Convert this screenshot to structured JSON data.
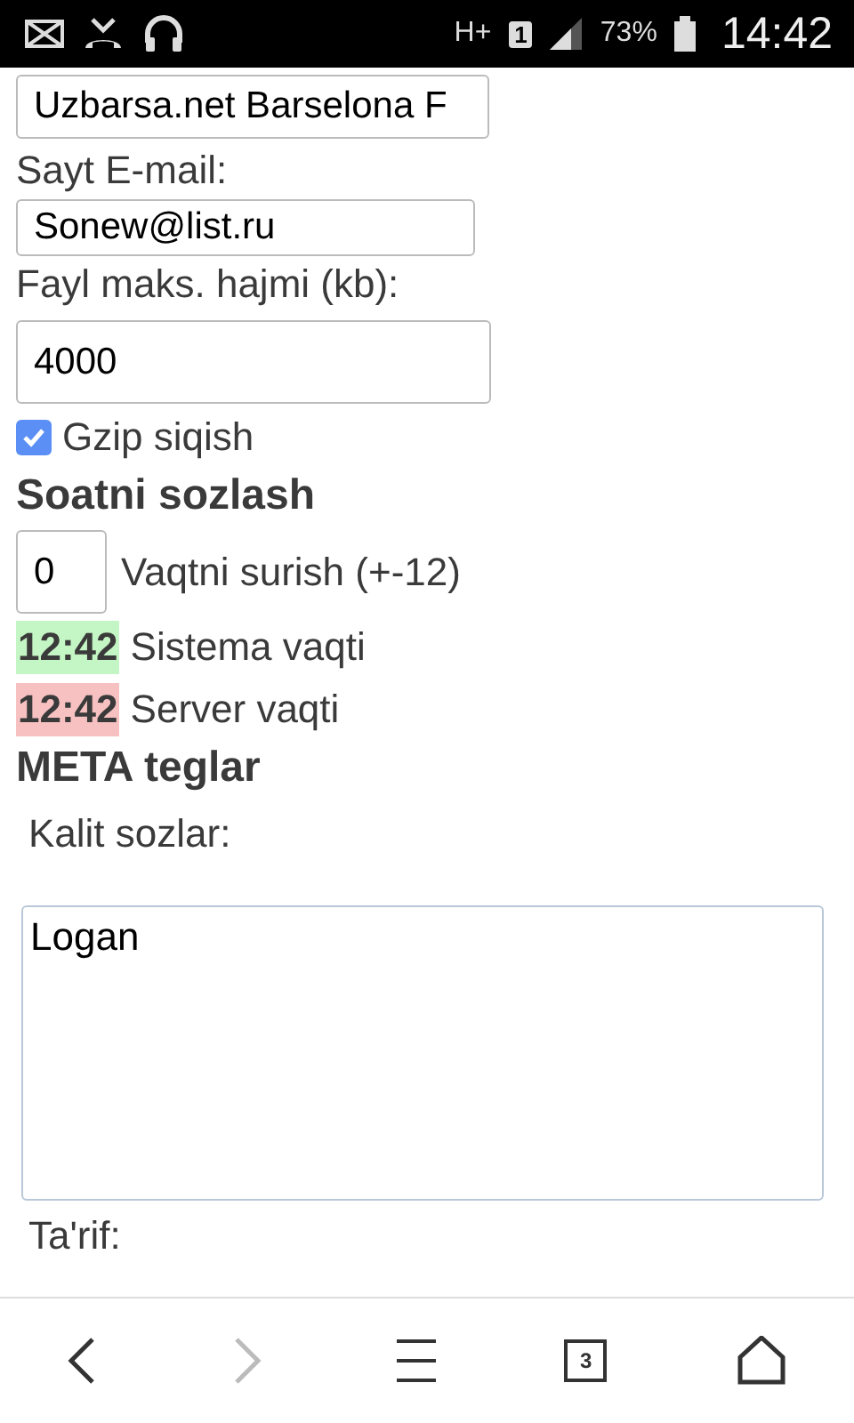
{
  "status_bar": {
    "network": "H+",
    "sim": "1",
    "battery": "73%",
    "time": "14:42"
  },
  "form": {
    "site_name_value": "Uzbarsa.net Barselona F",
    "email_label": "Sayt E-mail:",
    "email_value": "Sonew@list.ru",
    "size_label": "Fayl maks. hajmi (kb):",
    "size_value": "4000",
    "gzip": {
      "label": "Gzip siqish",
      "checked": true
    },
    "clock_heading": "Soatni sozlash",
    "offset_value": "0",
    "offset_label": "Vaqtni surish (+-12)",
    "times": [
      {
        "time": "12:42",
        "label": "Sistema vaqti",
        "color": "#c4f5c4"
      },
      {
        "time": "12:42",
        "label": "Server vaqti",
        "color": "#f7c1c1"
      }
    ],
    "meta_heading": "META teglar",
    "keywords_label": "Kalit sozlar:",
    "keywords_value": "Logan",
    "description_label": "Ta'rif:"
  },
  "nav": {
    "back_disabled": false,
    "forward_disabled": true,
    "tabs": "3"
  }
}
